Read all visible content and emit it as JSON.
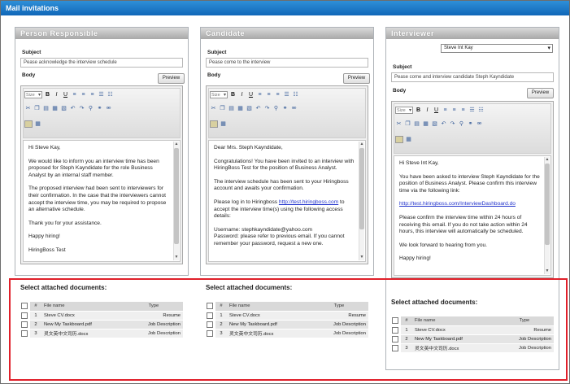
{
  "window": {
    "title": "Mail invitations"
  },
  "labels": {
    "subject": "Subject",
    "body": "Body",
    "preview": "Preview"
  },
  "size_select": "Size",
  "docs": {
    "title": "Select attached documents:",
    "columns": [
      "#",
      "File name",
      "Type"
    ],
    "rows": [
      {
        "num": "1",
        "file": "Steve CV.docx",
        "type": "Resume"
      },
      {
        "num": "2",
        "file": "New My Taskboard.pdf",
        "type": "Job Description"
      },
      {
        "num": "3",
        "file": "灵文英中文司历.docx",
        "type": "Job Description"
      }
    ]
  },
  "panels": {
    "person": {
      "title": "Person Responsible",
      "subject": "Pease acknowledge the interview schedule",
      "body": [
        "Hi Steve Kay,",
        "We would like to inform you an interview time has been proposed for Steph Kayndidate for the role Business Analyst by an internal staff member.",
        "The proposed interview had been sent to interviewers for their confirmation. In the case that the interviewers cannot accept the interview time, you may be required to propose an alternative schedule.",
        "Thank you for your assistance.",
        "Happy hiring!",
        "HiringBoss Test"
      ]
    },
    "candidate": {
      "title": "Candidate",
      "subject": "Pease come to the interview",
      "body_greeting": "Dear Mrs. Steph Kayndidate,",
      "body_p1": "Congratulations! You have been invited to an interview with HiringBoss Test for the position of Business Analyst.",
      "body_p2": "The interview schedule has been sent to your Hiringboss account and awaits your confirmation.",
      "body_p3_pre": "Please log in to Hiringboss ",
      "body_p3_link": "http://test.hiringboss.com",
      "body_p3_post": " to accept the interview time(s) using the following access details:",
      "body_p4": "Username: stephkayndidate@yahoo.com\nPassword: please refer to previous email. If you cannot remember your password, request a new one."
    },
    "interviewer": {
      "title": "Interviewer",
      "dropdown": "Steve Int Kay",
      "subject": "Pease come and interview candidate Steph Kayndidate",
      "body_greeting": "Hi Steve Int Kay,",
      "body_p1": "You have been asked to interview Steph Kayndidate for the position of Business Analyst. Please confirm this interview time via the following link:",
      "body_link": "http://test.hiringboss.com/InterviewDashboard.do",
      "body_p2": "Please confirm the interview time within 24 hours of receiving this email. If you do not take action within 24 hours, this interview will automatically be scheduled.",
      "body_p3": "We look forward to hearing from you.",
      "body_p4": "Happy hiring!"
    }
  }
}
